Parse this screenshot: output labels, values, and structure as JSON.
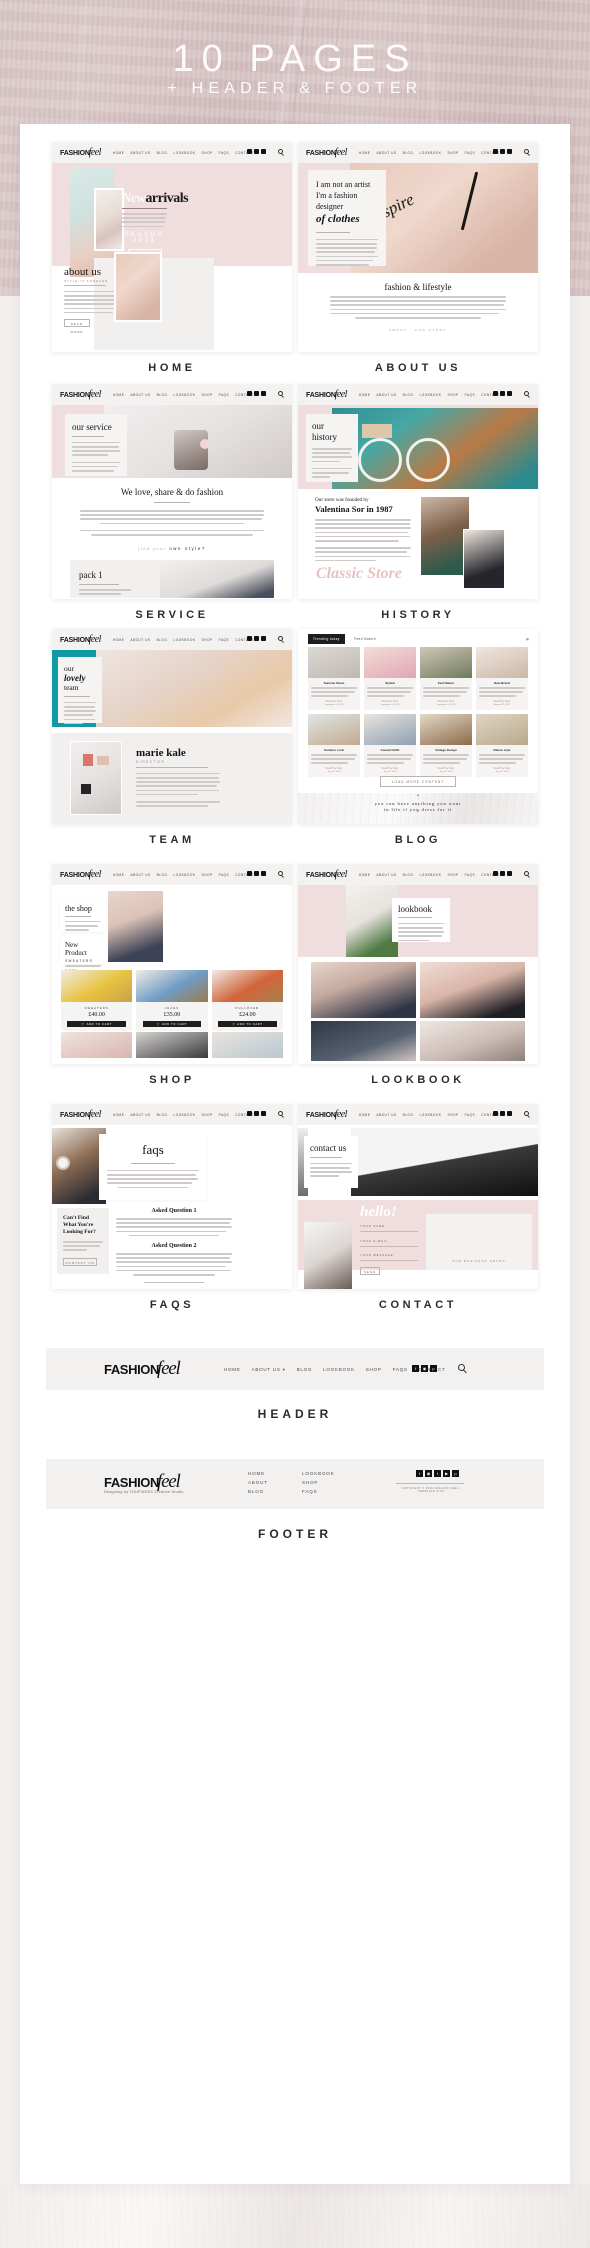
{
  "banner": {
    "title": "10 PAGES",
    "subtitle": "+ HEADER & FOOTER"
  },
  "brand": {
    "name_bold": "FASHION",
    "name_script": "feel",
    "tagline": "Designing by TOUFINGEX Creative Studio"
  },
  "nav": {
    "items": [
      "HOME",
      "ABOUT US",
      "BLOG",
      "LOOKBOOK",
      "SHOP",
      "FAQS",
      "CONTACT"
    ],
    "dropdown_caret": "▾",
    "search_icon": "search-icon",
    "social_icons": [
      "facebook",
      "instagram",
      "pinterest"
    ]
  },
  "pages": [
    {
      "label": "HOME",
      "hero_script": "New",
      "hero_title": "arrivals",
      "hero_season": "SEASON 2023",
      "hero_button": "DISCOVER MORE",
      "section_title": "about us",
      "section_sub": "STYLE IS FOREVER",
      "section_button": "READ MORE"
    },
    {
      "label": "ABOUT US",
      "line1": "I am not an artist",
      "line2": "I'm a fashion designer",
      "line3_script": "of clothes",
      "image_word": "Inspire",
      "section_title": "fashion & lifestyle",
      "footer_note": "ABOUT · OUR STORY"
    },
    {
      "label": "SERVICE",
      "hero_title": "our service",
      "section_title": "We love, share & do fashion",
      "accent_line_a": "find your",
      "accent_line_b": "own style?",
      "pack_title": "pack 1"
    },
    {
      "label": "HISTORY",
      "hero_title_1": "our",
      "hero_title_2": "history",
      "founded_small": "Our store was founded by",
      "founded_big": "Valentina Sor in 1987",
      "script_caption": "Classic Store"
    },
    {
      "label": "TEAM",
      "hero_1": "our",
      "hero_2_script": "lovely",
      "hero_3": "team",
      "member_name": "marie kale",
      "member_role": "DIRECTOR"
    },
    {
      "label": "BLOG",
      "tab_active": "Trending today",
      "tab_other": "Feed Nature",
      "posts": [
        {
          "title": "Summer Basic",
          "link": "Read The Story",
          "date": "September 5, 2020"
        },
        {
          "title": "Stylish",
          "link": "Read The Story",
          "date": "September 5, 2020"
        },
        {
          "title": "Feel Nature",
          "link": "Read The Story",
          "date": "September 5, 2020"
        },
        {
          "title": "New Brand",
          "link": "Read The Story",
          "date": "August 28, 2020"
        },
        {
          "title": "Summer Look",
          "link": "Read The Story",
          "date": "July 16, 2020"
        },
        {
          "title": "Casual Outfit",
          "link": "Read The Story",
          "date": "July 16, 2020"
        },
        {
          "title": "Vintage Design",
          "link": "Read The Story",
          "date": "July 16, 2020"
        },
        {
          "title": "Nature style",
          "link": "Read The Story",
          "date": "July 16, 2020"
        }
      ],
      "load_more": "LOAD MORE CONTENT",
      "quote_line1": "you can have anything you want",
      "quote_line2": "in life if you dress for it"
    },
    {
      "label": "SHOP",
      "hero_title": "the shop",
      "new_product_title": "New Product",
      "new_product_sub": "SWEATERS",
      "new_product_link": "Read More",
      "products": [
        {
          "name": "SWEATERS",
          "price": "£40.00",
          "button": "ADD TO CART"
        },
        {
          "name": "JEANS",
          "price": "£35.00",
          "button": "ADD TO CART"
        },
        {
          "name": "PULLOVER",
          "price": "£24.00",
          "button": "ADD TO CART"
        }
      ]
    },
    {
      "label": "LOOKBOOK",
      "hero_title": "lookbook"
    },
    {
      "label": "FAQS",
      "hero_title": "faqs",
      "q1": "Asked Question 1",
      "q2": "Asked Question 2",
      "side_title_1": "Can't Find",
      "side_title_2": "What You're",
      "side_title_3": "Looking For?",
      "side_button": "CONTACT US"
    },
    {
      "label": "CONTACT",
      "hero_title": "contact us",
      "script_title": "hello!",
      "field_labels": [
        "YOUR NAME",
        "YOUR E-MAIL",
        "YOUR MESSAGE"
      ],
      "send_button": "SEND",
      "hours_label": "OUR BUSINESS HOURS"
    }
  ],
  "header_showcase": {
    "label": "HEADER"
  },
  "footer_showcase": {
    "label": "FOOTER",
    "col1": [
      "HOME",
      "ABOUT",
      "BLOG"
    ],
    "col2": [
      "LOOKBOOK",
      "SHOP",
      "FAQS"
    ],
    "social_icons": [
      "facebook",
      "instagram",
      "twitter",
      "youtube",
      "pinterest"
    ],
    "copyright": "COPYRIGHT © 2020 FASHION FEEL | TEMPLATE KITS"
  },
  "colors": {
    "banner_pink": "#d7c3c4",
    "blush": "#f0dede",
    "teal": "#0f9aa6",
    "ink": "#1d1d1d",
    "paper": "#f4f2f1"
  }
}
